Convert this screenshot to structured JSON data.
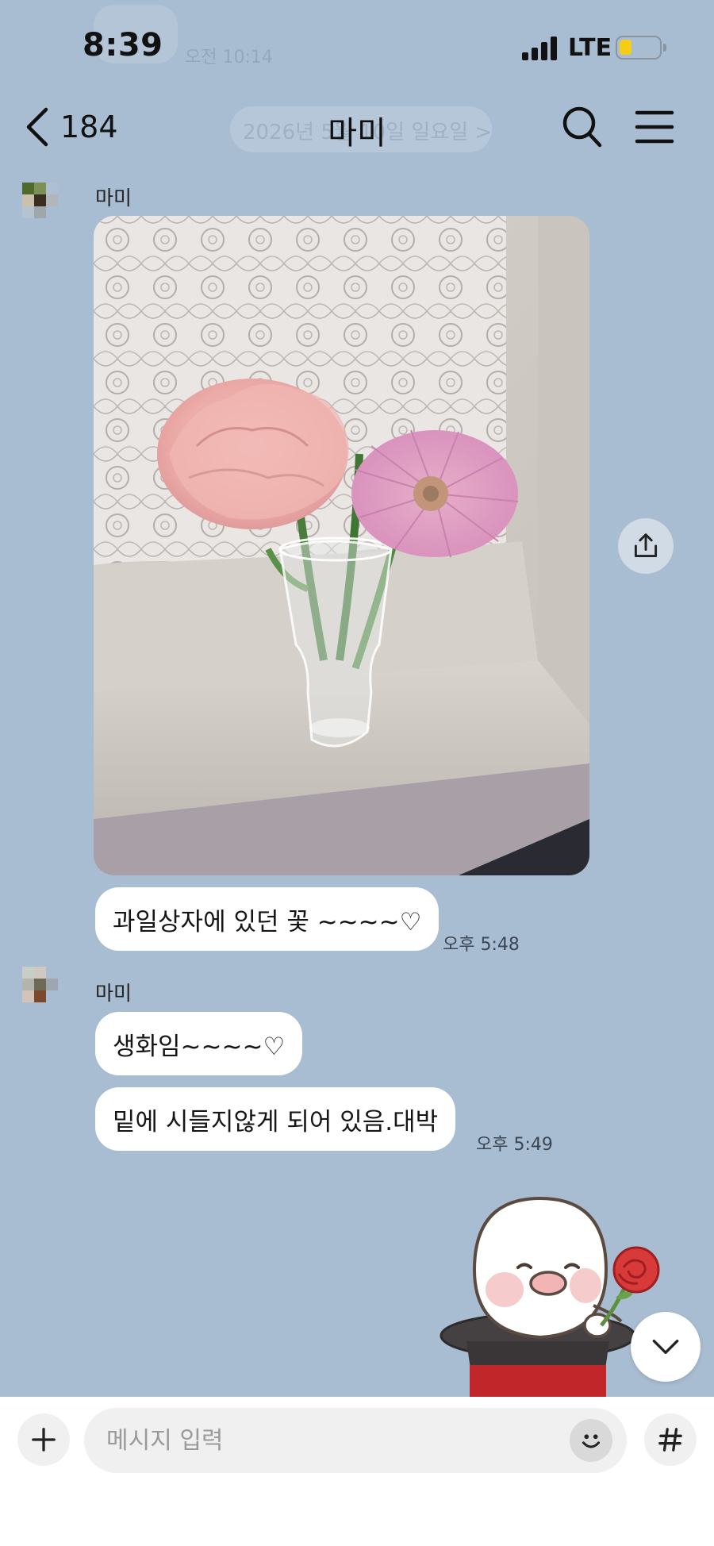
{
  "status_bar": {
    "time": "8:39",
    "network": "LTE",
    "faded_notice_text": "오전 10:14"
  },
  "header": {
    "back_count": "184",
    "title": "마미",
    "faded_date_text": "2026년 5월 10일 일요일 >"
  },
  "messages": [
    {
      "sender": "마미",
      "photo_alt": "Pink carnation and gerbera in a glass on a windowsill",
      "text": "과일상자에 있던 꽃 ~~~~♡",
      "time": "오후 5:48"
    },
    {
      "sender": "마미",
      "texts": [
        "생화임~~~~♡",
        "밑에 시들지않게 되어 있음.대박"
      ],
      "time": "오후 5:49"
    }
  ],
  "input": {
    "placeholder": "메시지 입력"
  },
  "colors": {
    "chat_background": "#a9bdd2",
    "bubble": "#ffffff",
    "battery_level": "#f5cd16"
  },
  "icons": [
    "chevron-left-icon",
    "search-icon",
    "menu-icon",
    "share-icon",
    "chevron-down-icon",
    "plus-icon",
    "emoji-icon",
    "hash-icon"
  ]
}
